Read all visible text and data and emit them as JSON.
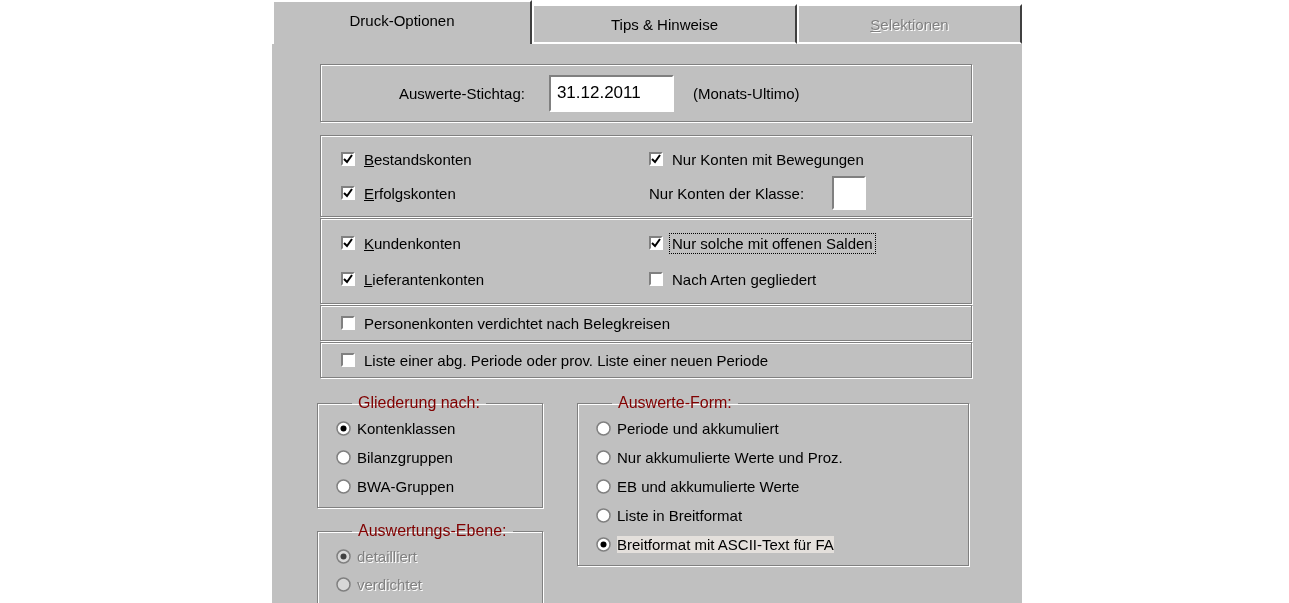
{
  "tabs": [
    {
      "label": "Druck-Optionen",
      "selected": true,
      "disabled": false,
      "access_key": false
    },
    {
      "label": "Tips & Hinweise",
      "selected": false,
      "disabled": false,
      "access_key": false
    },
    {
      "label": "Selektionen",
      "selected": false,
      "disabled": true,
      "access_key": true
    }
  ],
  "stichtag": {
    "label": "Auswerte-Stichtag:",
    "value": "31.12.2011",
    "hint": "(Monats-Ultimo)"
  },
  "sections": [
    {
      "items": [
        {
          "kind": "checkbox",
          "label": "Bestandskonten",
          "checked": true,
          "focused": false,
          "access_key": true
        },
        {
          "kind": "checkbox",
          "label": "Nur Konten mit Bewegungen",
          "checked": true,
          "focused": false,
          "access_key": false
        },
        {
          "kind": "checkbox",
          "label": "Erfolgskonten",
          "checked": true,
          "focused": false,
          "access_key": true
        },
        {
          "kind": "field",
          "label": "Nur Konten der Klasse:"
        }
      ]
    },
    {
      "items": [
        {
          "kind": "checkbox",
          "label": "Kundenkonten",
          "checked": true,
          "focused": false,
          "access_key": true
        },
        {
          "kind": "checkbox",
          "label": "Nur solche mit offenen Salden",
          "checked": true,
          "focused": true,
          "access_key": false
        },
        {
          "kind": "checkbox",
          "label": "Lieferantenkonten",
          "checked": true,
          "focused": false,
          "access_key": true
        },
        {
          "kind": "checkbox",
          "label": "Nach Arten gegliedert",
          "checked": false,
          "focused": false,
          "access_key": false
        }
      ]
    },
    {
      "items": [
        {
          "kind": "checkbox",
          "label": "Personenkonten verdichtet nach Belegkreisen",
          "checked": false,
          "focused": false,
          "access_key": false
        }
      ]
    },
    {
      "items": [
        {
          "kind": "checkbox",
          "label": "Liste einer abg. Periode oder prov. Liste einer neuen Periode",
          "checked": false,
          "focused": false,
          "access_key": false
        }
      ]
    }
  ],
  "gliederung": {
    "title": "Gliederung nach:",
    "options": [
      {
        "label": "Kontenklassen",
        "selected": true,
        "disabled": false,
        "focused": false
      },
      {
        "label": "Bilanzgruppen",
        "selected": false,
        "disabled": false,
        "focused": false
      },
      {
        "label": "BWA-Gruppen",
        "selected": false,
        "disabled": false,
        "focused": false
      }
    ]
  },
  "auswertungs_ebene": {
    "title": "Auswertungs-Ebene:",
    "options": [
      {
        "label": "detailliert",
        "selected": true,
        "disabled": true,
        "focused": false
      },
      {
        "label": "verdichtet",
        "selected": false,
        "disabled": true,
        "focused": false
      }
    ]
  },
  "auswerte_form": {
    "title": "Auswerte-Form:",
    "options": [
      {
        "label": "Periode und akkumuliert",
        "selected": false,
        "disabled": false,
        "focused": false
      },
      {
        "label": "Nur akkumulierte Werte und Proz.",
        "selected": false,
        "disabled": false,
        "focused": false
      },
      {
        "label": "EB und akkumulierte Werte",
        "selected": false,
        "disabled": false,
        "focused": false
      },
      {
        "label": "Liste in Breitformat",
        "selected": false,
        "disabled": false,
        "focused": false
      },
      {
        "label": "Breitformat mit ASCII-Text für FA",
        "selected": true,
        "disabled": false,
        "focused": true
      }
    ]
  }
}
